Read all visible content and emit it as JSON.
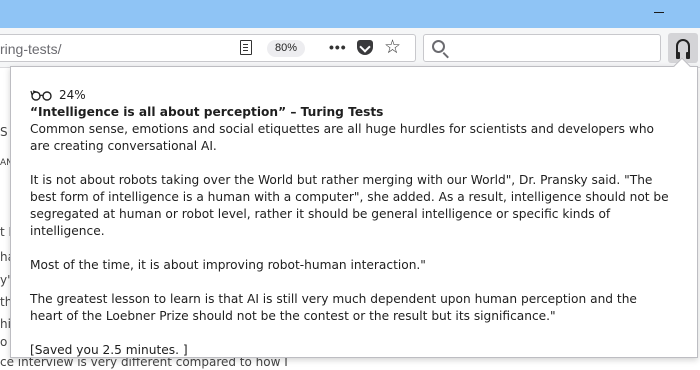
{
  "browser": {
    "url_text": "ring-tests/",
    "zoom": "80%"
  },
  "background_page": {
    "fragments": [
      "S",
      "AN",
      "t E",
      "ha",
      "y's",
      "th",
      "hi",
      "o"
    ],
    "bottom_text": "ce interview is very different compared to how I"
  },
  "popup": {
    "percent": "24%",
    "title": "“Intelligence is all about perception” – Turing Tests",
    "paragraphs": [
      "Common sense, emotions and social etiquettes are all huge hurdles for scientists and developers who are creating conversational AI.",
      "It is not about robots taking over the World but rather merging with our World\", Dr. Pransky said. \"The best form of intelligence is a human with a computer\", she added. As a result, intelligence should not be segregated at human or robot level, rather it should be general intelligence or specific kinds of intelligence.",
      "Most of the time, it is about improving robot-human interaction.\"",
      "The greatest lesson to learn is that AI is still very much dependent upon human perception and the heart of the Loebner Prize should not be the contest or the result but its significance.\""
    ],
    "saved_text": "[Saved you 2.5 minutes. ]"
  }
}
